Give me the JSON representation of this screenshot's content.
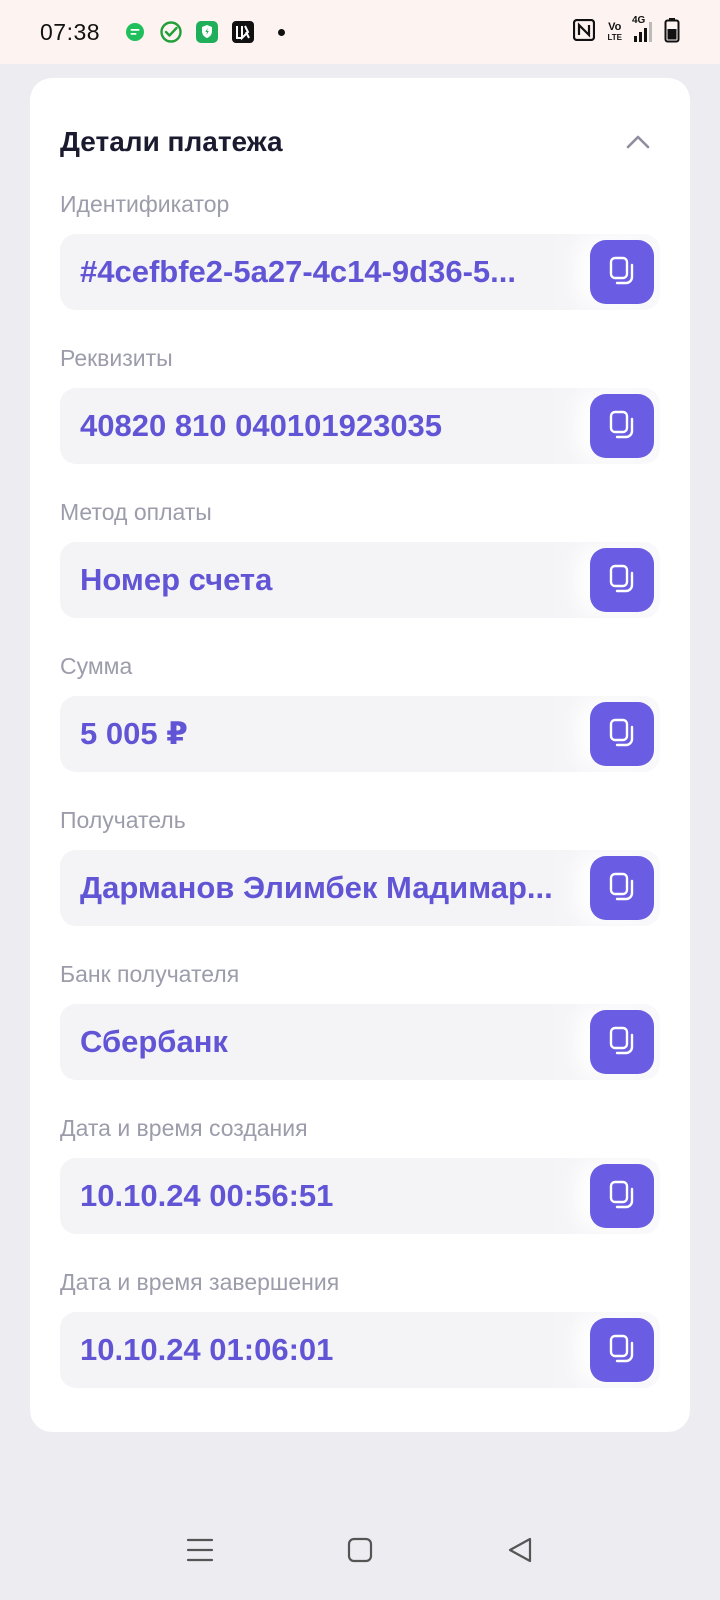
{
  "status_bar": {
    "time": "07:38",
    "volte_top": "Vo",
    "volte_bottom": "LTE",
    "network": "4G"
  },
  "card": {
    "title": "Детали платежа",
    "fields": [
      {
        "label": "Идентификатор",
        "value": "#4cefbfe2-5a27-4c14-9d36-5..."
      },
      {
        "label": "Реквизиты",
        "value": "40820 810 040101923035"
      },
      {
        "label": "Метод оплаты",
        "value": "Номер счета"
      },
      {
        "label": "Сумма",
        "value": "5 005 ₽"
      },
      {
        "label": "Получатель",
        "value": "Дарманов Элимбек Мадимар..."
      },
      {
        "label": "Банк получателя",
        "value": "Сбербанк"
      },
      {
        "label": "Дата и время создания",
        "value": "10.10.24 00:56:51"
      },
      {
        "label": "Дата и время завершения",
        "value": "10.10.24 01:06:01"
      }
    ]
  },
  "colors": {
    "accent": "#6b5de3",
    "value_text": "#6155d6",
    "label_text": "#9c9cab",
    "background": "#ececf1"
  },
  "icons": {
    "notifications": [
      "message-icon",
      "check-circle-icon",
      "shield-icon",
      "lukoil-icon"
    ],
    "system": [
      "nfc-icon",
      "volte-icon",
      "signal-4g-icon",
      "battery-icon"
    ],
    "copy": "copy-icon",
    "collapse": "chevron-up-icon",
    "nav": [
      "menu-icon",
      "home-icon",
      "back-icon"
    ]
  }
}
